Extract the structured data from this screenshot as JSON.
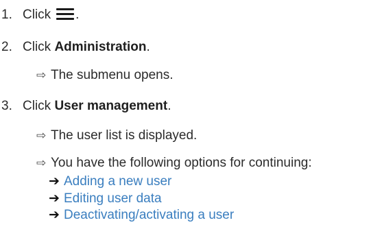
{
  "steps": [
    {
      "number": "1.",
      "prefix": "Click",
      "icon": "hamburger-menu-icon",
      "suffix": "."
    },
    {
      "number": "2.",
      "prefix": "Click",
      "target": "Administration",
      "suffix": ".",
      "result": "The submenu opens."
    },
    {
      "number": "3.",
      "prefix": "Click",
      "target": "User management",
      "suffix": ".",
      "results": [
        "The user list is displayed.",
        "You have the following options for continuing:"
      ],
      "links": [
        "Adding a new user",
        "Editing user data",
        "Deactivating/activating a user"
      ]
    }
  ],
  "colors": {
    "text": "#2b2b2b",
    "link": "#3a7ebf"
  },
  "symbols": {
    "result_arrow": "⇨",
    "link_arrow": "➔"
  }
}
